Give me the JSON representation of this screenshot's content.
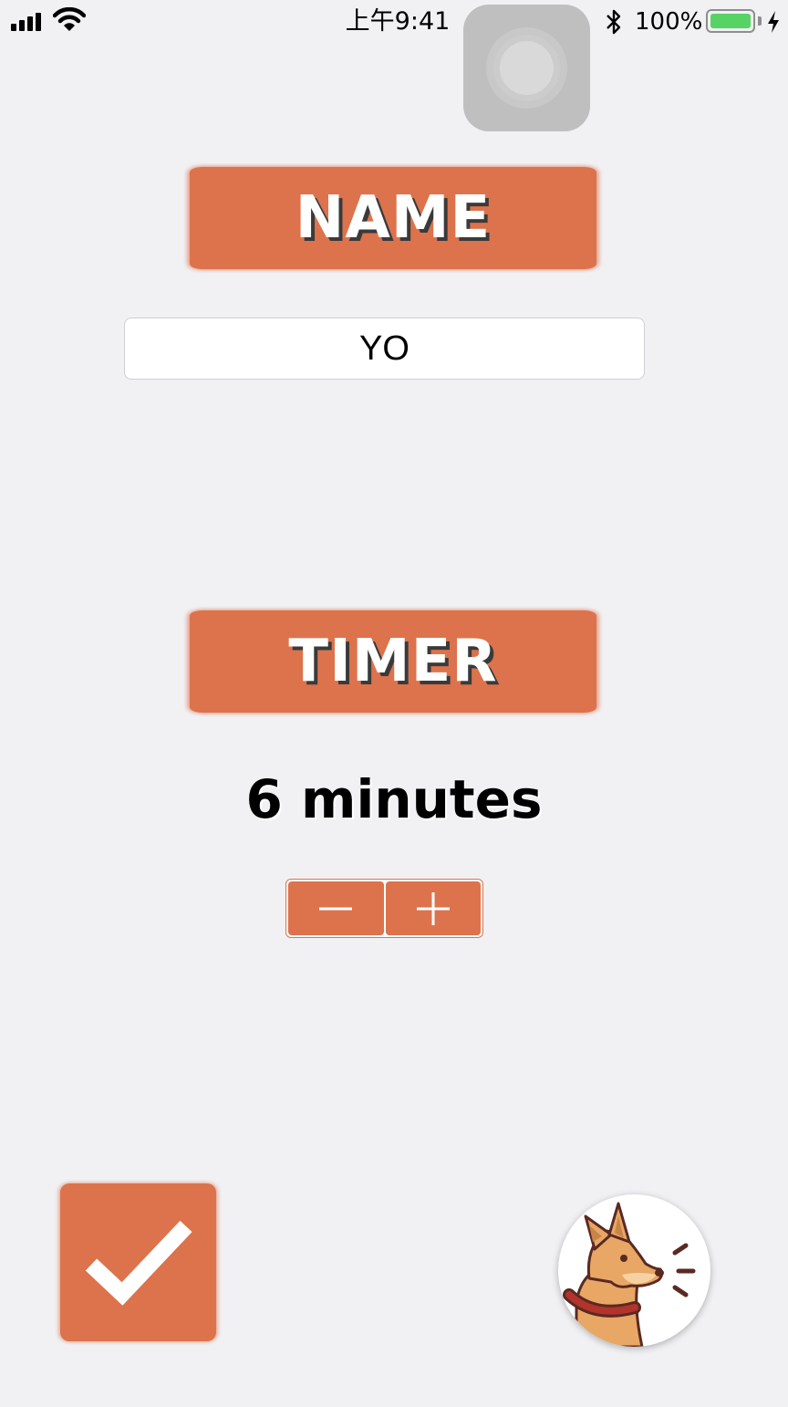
{
  "status_bar": {
    "time": "上午9:41",
    "battery_percent": "100%",
    "battery_level": 1.0,
    "battery_color": "#56D364",
    "icons": [
      "cellular-signal-icon",
      "wifi-icon",
      "bluetooth-icon",
      "battery-icon",
      "charging-bolt-icon"
    ]
  },
  "assistive_touch": {
    "icon": "assistive-touch-icon"
  },
  "name_section": {
    "header": "NAME",
    "input_value": "YO"
  },
  "timer_section": {
    "header": "TIMER",
    "minutes_label": "6 minutes",
    "stepper": {
      "decrement_icon": "minus-icon",
      "increment_icon": "plus-icon"
    }
  },
  "actions": {
    "confirm_icon": "checkmark-icon",
    "dog_icon": "barking-dog-icon"
  },
  "colors": {
    "accent": "#DC734C",
    "background": "#F1F1F4",
    "header_shadow": "#3A3A3A"
  }
}
